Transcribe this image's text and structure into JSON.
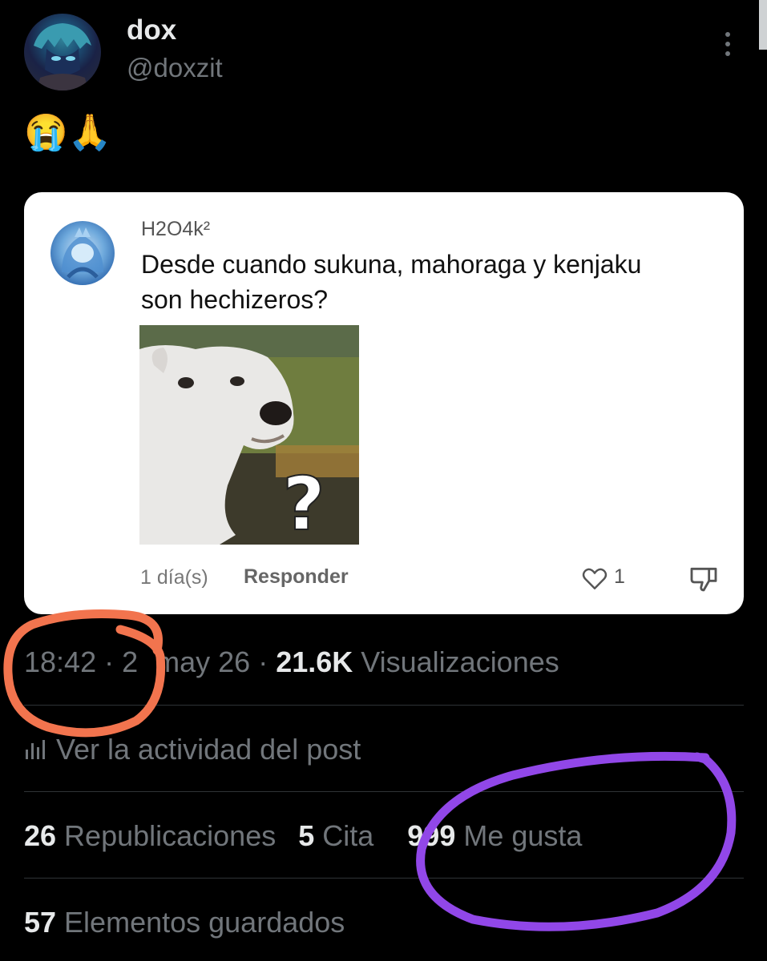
{
  "post": {
    "author": {
      "display_name": "dox",
      "handle": "@doxzit",
      "avatar_icon": "avatar"
    },
    "body_text": "😭🙏",
    "more_icon": "more-vertical-icon"
  },
  "quoted_comment": {
    "username": "H2O4k²",
    "text": "Desde cuando sukuna, mahoraga y kenjaku son hechizeros?",
    "image_desc_icon": "dog-question-mark-image",
    "time_ago": "1 día(s)",
    "reply_label": "Responder",
    "like_count": "1",
    "like_icon": "heart-icon",
    "dislike_icon": "thumbs-down-icon"
  },
  "meta": {
    "time": "18:42",
    "sep1": " · ",
    "date_prefix": "2",
    "date_rest": "may 26",
    "sep2": " · ",
    "views_count": "21.6K",
    "views_label": " Visualizaciones"
  },
  "activity": {
    "icon": "bar-chart-icon",
    "label": "Ver la actividad del post"
  },
  "stats": {
    "reposts_count": "26",
    "reposts_label": " Republicaciones",
    "quotes_count": "5",
    "quotes_label": " Cita",
    "likes_count": "999",
    "likes_label": " Me gusta",
    "saved_count": "57",
    "saved_label": " Elementos guardados"
  },
  "colors": {
    "background": "#000000",
    "primary_text": "#e7e9ea",
    "secondary_text": "#71767b",
    "annotation_orange": "#f2744e",
    "annotation_purple": "#9147e8"
  }
}
